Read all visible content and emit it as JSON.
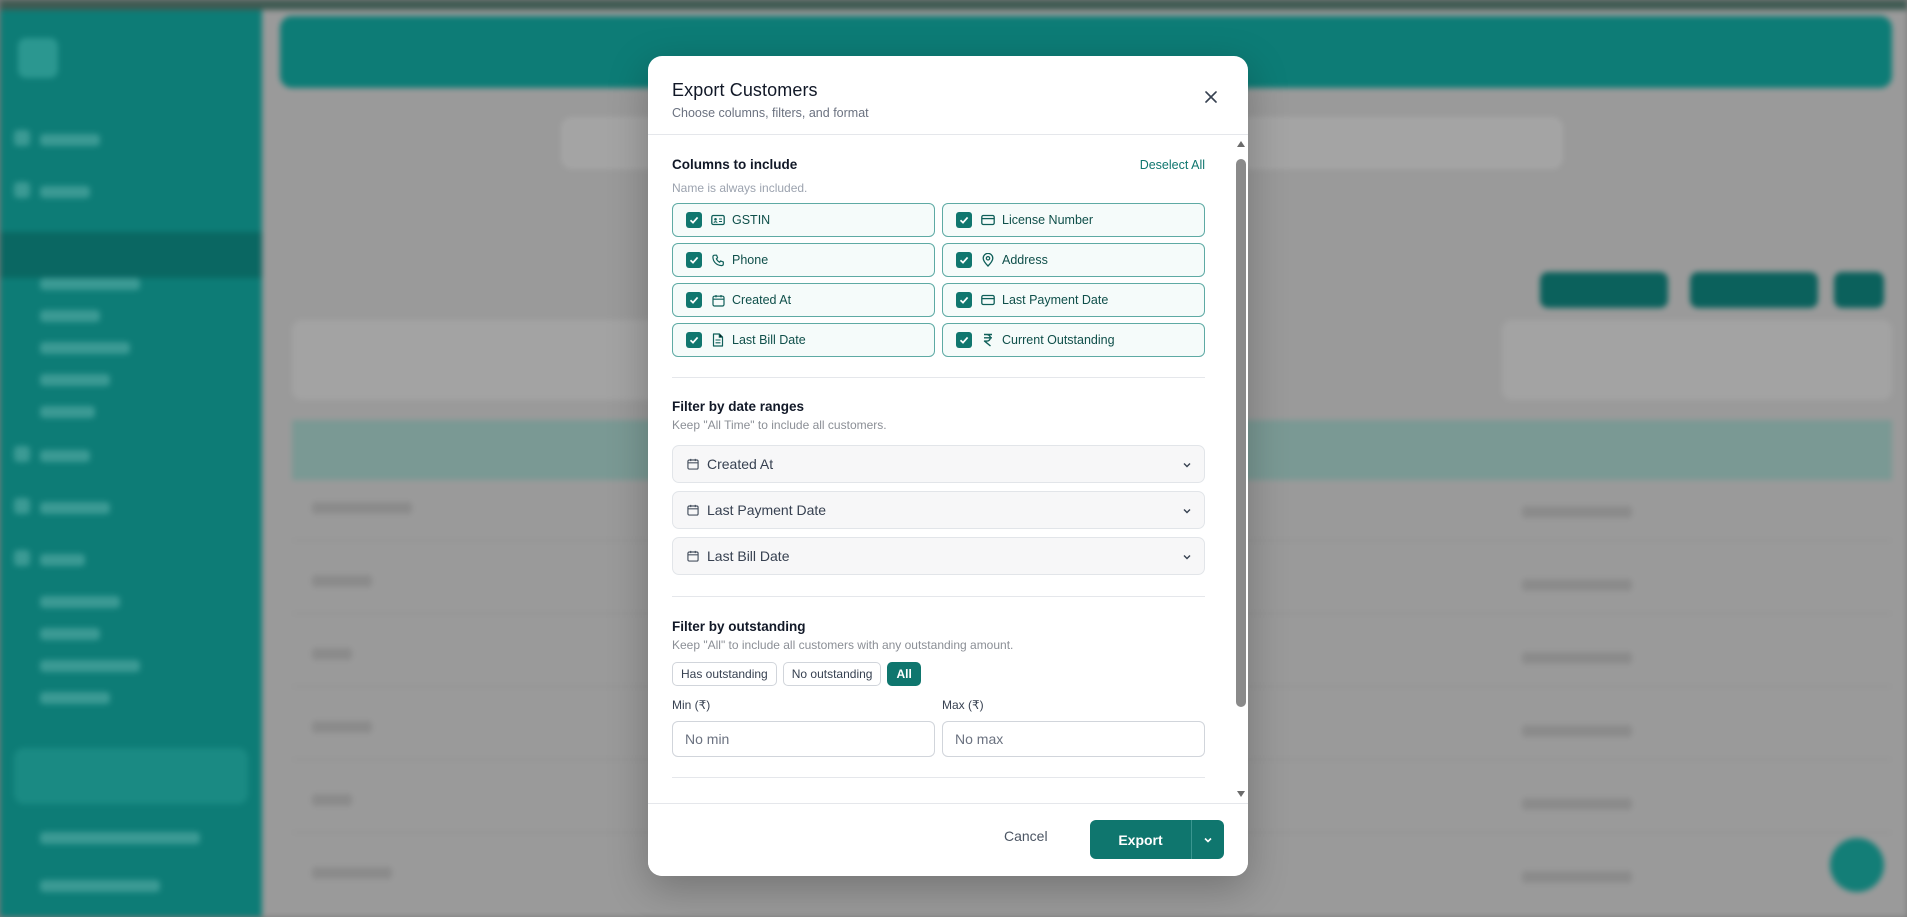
{
  "modal": {
    "title": "Export Customers",
    "subtitle": "Choose columns, filters, and format",
    "close_icon": "close-icon"
  },
  "columns_section": {
    "title": "Columns to include",
    "toggle_label": "Deselect All",
    "hint": "Name is always included.",
    "items": [
      {
        "label": "GSTIN",
        "icon": "id-card-icon",
        "checked": true
      },
      {
        "label": "License Number",
        "icon": "credit-card-icon",
        "checked": true
      },
      {
        "label": "Phone",
        "icon": "phone-icon",
        "checked": true
      },
      {
        "label": "Address",
        "icon": "map-pin-icon",
        "checked": true
      },
      {
        "label": "Created At",
        "icon": "calendar-icon",
        "checked": true
      },
      {
        "label": "Last Payment Date",
        "icon": "credit-card-icon",
        "checked": true
      },
      {
        "label": "Last Bill Date",
        "icon": "document-icon",
        "checked": true
      },
      {
        "label": "Current Outstanding",
        "icon": "rupee-icon",
        "checked": true
      }
    ]
  },
  "date_filters": {
    "title": "Filter by date ranges",
    "hint": "Keep \"All Time\" to include all customers.",
    "items": [
      {
        "label": "Created At"
      },
      {
        "label": "Last Payment Date"
      },
      {
        "label": "Last Bill Date"
      }
    ]
  },
  "outstanding_filter": {
    "title": "Filter by outstanding",
    "hint": "Keep \"All\" to include all customers with any outstanding amount.",
    "options": [
      "Has outstanding",
      "No outstanding",
      "All"
    ],
    "selected": "All",
    "min_label": "Min (₹)",
    "min_placeholder": "No min",
    "min_value": "",
    "max_label": "Max (₹)",
    "max_placeholder": "No max",
    "max_value": ""
  },
  "footer": {
    "cancel_label": "Cancel",
    "export_label": "Export"
  },
  "colors": {
    "accent": "#0f766e",
    "overlay": "#7c7c7c",
    "sidebar": "#0d7c76"
  }
}
